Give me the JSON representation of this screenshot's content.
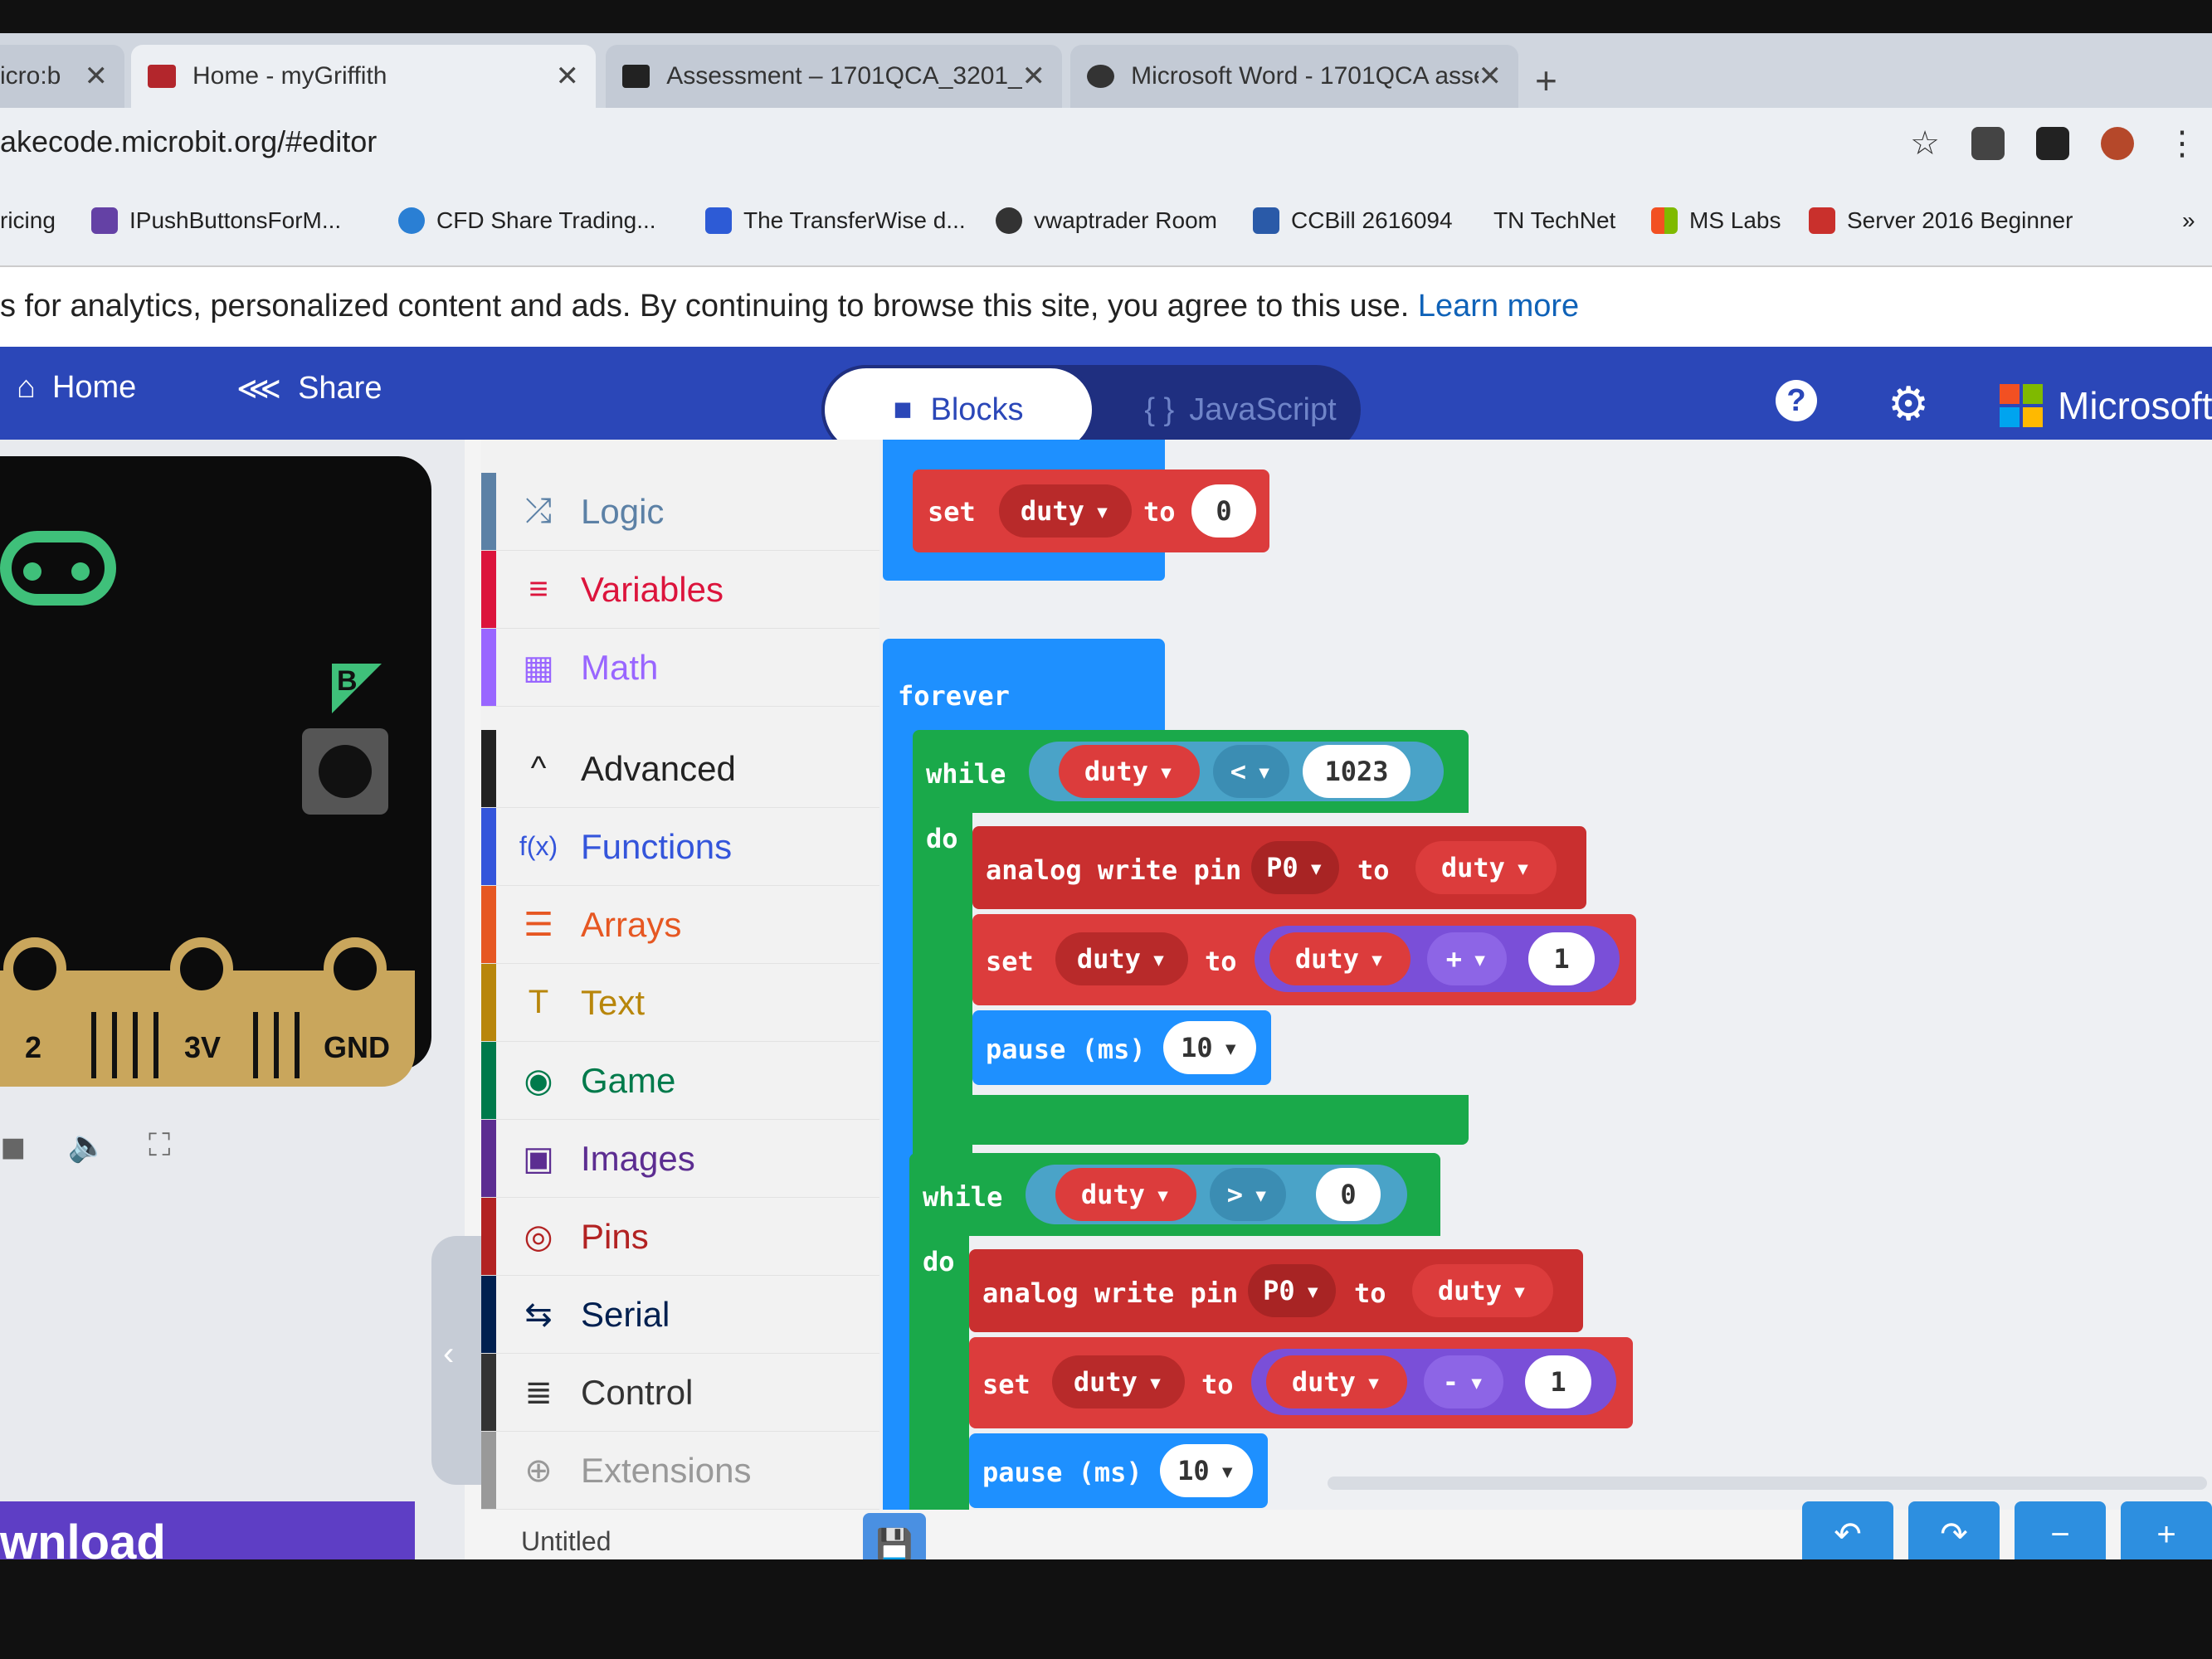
{
  "tabs": [
    {
      "label": "icro:b",
      "active": false
    },
    {
      "label": "Home - myGriffith",
      "active": true
    },
    {
      "label": "Assessment – 1701QCA_3201_(",
      "active": false
    },
    {
      "label": "Microsoft Word - 1701QCA asse",
      "active": false
    }
  ],
  "tab_close": "✕",
  "new_tab": "+",
  "url": "akecode.microbit.org/#editor",
  "bookmarks": [
    {
      "label": "ricing",
      "color": "#eceff3"
    },
    {
      "label": "IPushButtonsForM...",
      "color": "#6441a5"
    },
    {
      "label": "CFD Share Trading...",
      "color": "#2a7fd4"
    },
    {
      "label": "The TransferWise d...",
      "color": "#2d5bd6"
    },
    {
      "label": "vwaptrader Room",
      "color": "#333333"
    },
    {
      "label": "CCBill 2616094",
      "color": "#2a5aa8"
    },
    {
      "label": "TN  TechNet",
      "color": "#eceff3"
    },
    {
      "label": "MS Labs",
      "color": "#f25022"
    },
    {
      "label": "Server 2016 Beginner",
      "color": "#c9302c"
    }
  ],
  "bookmarks_more": "»",
  "cookie": {
    "text": "s for analytics, personalized content and ads. By continuing to browse this site, you agree to this use.",
    "link": "Learn more"
  },
  "header": {
    "home": "Home",
    "share": "Share",
    "blocks": "Blocks",
    "javascript": "JavaScript",
    "help": "?",
    "brand": "Microsoft"
  },
  "simulator": {
    "pins": [
      "2",
      "3V",
      "GND"
    ],
    "download": "wnload"
  },
  "toolbox": {
    "categories": [
      {
        "label": "Logic",
        "color": "#5c81a6",
        "icon": "⤮"
      },
      {
        "label": "Variables",
        "color": "#dc143c",
        "icon": "≡"
      },
      {
        "label": "Math",
        "color": "#9966ff",
        "icon": "▦"
      },
      {
        "label": "Advanced",
        "color": "#222222",
        "icon": "^"
      },
      {
        "label": "Functions",
        "color": "#3455db",
        "icon": "f(x)"
      },
      {
        "label": "Arrays",
        "color": "#e65722",
        "icon": "☰"
      },
      {
        "label": "Text",
        "color": "#b8860b",
        "icon": "T"
      },
      {
        "label": "Game",
        "color": "#007a4b",
        "icon": "◉"
      },
      {
        "label": "Images",
        "color": "#5c2d91",
        "icon": "▣"
      },
      {
        "label": "Pins",
        "color": "#b22222",
        "icon": "◎"
      },
      {
        "label": "Serial",
        "color": "#002050",
        "icon": "⇆"
      },
      {
        "label": "Control",
        "color": "#333333",
        "icon": "≣"
      },
      {
        "label": "Extensions",
        "color": "#999999",
        "icon": "⊕"
      }
    ],
    "filename": "Untitled"
  },
  "code": {
    "kw_set": "set",
    "kw_to": "to",
    "kw_forever": "forever",
    "kw_while": "while",
    "kw_do": "do",
    "kw_analog": "analog write pin",
    "kw_pause": "pause (ms)",
    "var": "duty",
    "pin": "P0",
    "init_value": "0",
    "op_lt": "<",
    "op_gt": ">",
    "op_plus": "+",
    "op_minus": "-",
    "limit": "1023",
    "zero": "0",
    "step": "1",
    "pause_ms": "10"
  },
  "colors": {
    "header": "#2b47b8",
    "variables": "#dc3c3c",
    "loops": "#1aa94a",
    "basic": "#1e90ff",
    "math": "#9966ff",
    "logic": "#4aa3c8"
  }
}
